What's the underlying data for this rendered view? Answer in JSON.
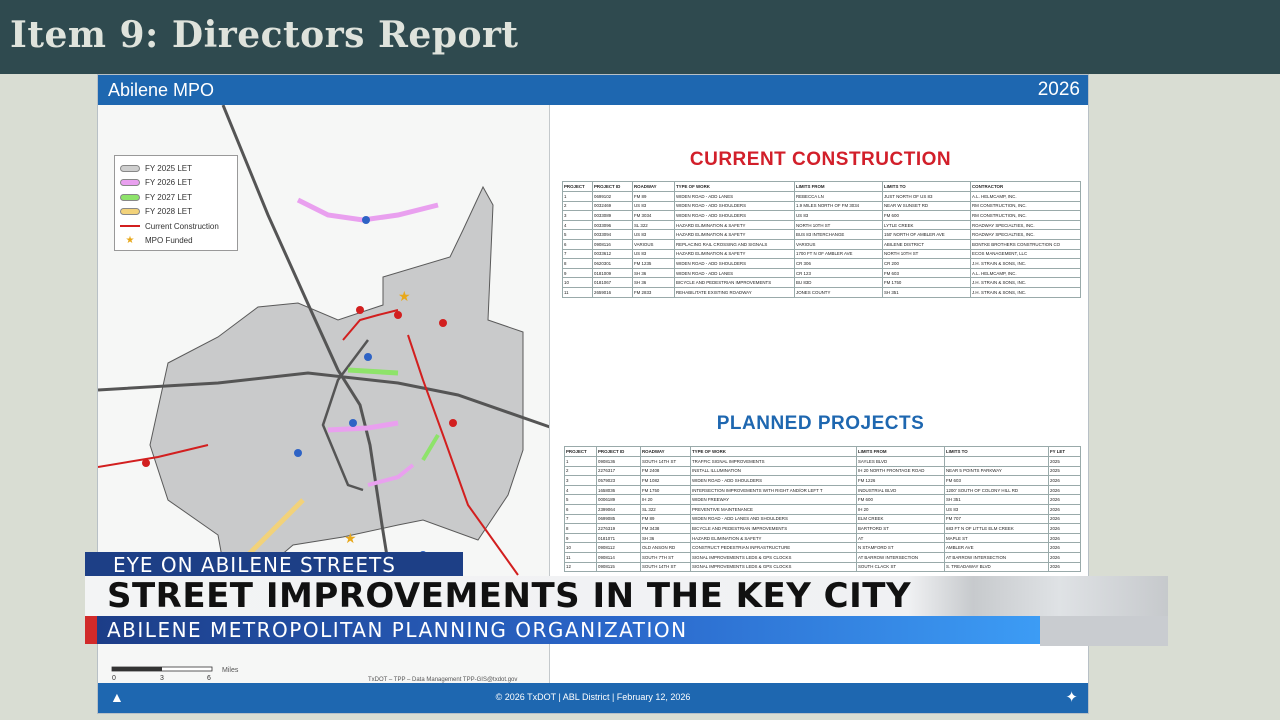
{
  "header": {
    "title": "Item 9: Directors Report"
  },
  "slide": {
    "org": "Abilene MPO",
    "year": "2026",
    "footer": "© 2026 TxDOT | ABL District | February 12, 2026",
    "north_arrow": "north-arrow-icon",
    "logo_icon": "txdot-logo-icon"
  },
  "map": {
    "legend": [
      {
        "label": "FY 2025 LET",
        "color": "#cfcfcf"
      },
      {
        "label": "FY 2026 LET",
        "color": "#e9a0ef"
      },
      {
        "label": "FY 2027 LET",
        "color": "#8ee36a"
      },
      {
        "label": "FY 2028 LET",
        "color": "#f2d27a"
      },
      {
        "label": "Current Construction",
        "color": "#d21f1f"
      },
      {
        "label": "MPO Funded",
        "color": "#e8a81a"
      }
    ],
    "reference": "TxDOT – TPP – Data Management TPP-GIS@txdot.gov",
    "scale_label": "Miles",
    "scale_ticks": [
      "0",
      "3",
      "6"
    ]
  },
  "current_construction": {
    "title": "CURRENT CONSTRUCTION",
    "columns": [
      "PROJECT",
      "PROJECT ID",
      "ROADWAY",
      "TYPE OF WORK",
      "LIMITS FROM",
      "LIMITS TO",
      "CONTRACTOR"
    ],
    "rows": [
      [
        "1",
        "0699102",
        "FM 89",
        "WIDEN ROAD - ADD LANES",
        "REBECCA LN",
        "JUST NORTH OF US 83",
        "A.L. HELMCAMP, INC."
      ],
      [
        "2",
        "0032469",
        "US 83",
        "WIDEN ROAD - ADD SHOULDERS",
        "1.9 MILES NORTH OF FM 3034",
        "NEAR W SUNSET RD",
        "RM CONSTRUCTION, INC."
      ],
      [
        "3",
        "0033089",
        "FM 3034",
        "WIDEN ROAD - ADD SHOULDERS",
        "US 83",
        "FM 600",
        "RM CONSTRUCTION, INC."
      ],
      [
        "4",
        "0033096",
        "SL 322",
        "HAZARD ELIMINATION & SAFETY",
        "NORTH 10TH ST",
        "LYTLE CREEK",
        "ROADWAY SPECIALTIES, INC."
      ],
      [
        "5",
        "0033094",
        "US 83",
        "HAZARD ELIMINATION & SAFETY",
        "BUS 83 INTERCHANGE",
        "150' NORTH OF AMBLER AVE",
        "ROADWAY SPECIALTIES, INC."
      ],
      [
        "6",
        "0908116",
        "VARIOUS",
        "REPLACING RAIL CROSSING AND SIGNALS",
        "VARIOUS",
        "ABILENE DISTRICT",
        "BONTKE BROTHERS CONSTRUCTION CO"
      ],
      [
        "7",
        "0033612",
        "US 83",
        "HAZARD ELIMINATION & SAFETY",
        "1700 FT N OF AMBLER AVE",
        "NORTH 10TH ST",
        "ECOS MANAGEMENT, LLC"
      ],
      [
        "8",
        "0620301",
        "FM 1235",
        "WIDEN ROAD - ADD SHOULDERS",
        "CR 306",
        "CR 200",
        "J.H. STRAIN & SONS, INC."
      ],
      [
        "9",
        "0181009",
        "SH 36",
        "WIDEN ROAD - ADD LANES",
        "CR 123",
        "FM 603",
        "A.L. HELMCAMP, INC."
      ],
      [
        "10",
        "0181067",
        "SH 36",
        "BICYCLE AND PEDESTRIAN IMPROVEMENTS",
        "BU 83D",
        "FM 1750",
        "J.H. STRAIN & SONS, INC."
      ],
      [
        "11",
        "2659016",
        "FM 2833",
        "REHABILITATE EXISTING ROADWAY",
        "JONES COUNTY",
        "SH 351",
        "J.H. STRAIN & SONS, INC."
      ]
    ]
  },
  "planned_projects": {
    "title": "PLANNED PROJECTS",
    "columns": [
      "PROJECT",
      "PROJECT ID",
      "ROADWAY",
      "TYPE OF WORK",
      "LIMITS FROM",
      "LIMITS TO",
      "FY LET"
    ],
    "rows": [
      [
        "1",
        "0908136",
        "SOUTH 14TH ST",
        "TRAFFIC SIGNAL IMPROVEMENTS",
        "SAYLES BLVD",
        "",
        "2025"
      ],
      [
        "2",
        "2276317",
        "FM 2408",
        "INSTALL ILLUMINATION",
        "IH 20 NORTH FRONTAGE ROAD",
        "NEAR 5 POINTS PARKWAY",
        "2025"
      ],
      [
        "3",
        "0579023",
        "FM 1082",
        "WIDEN ROAD - ADD SHOULDERS",
        "FM 1226",
        "FM 603",
        "2026"
      ],
      [
        "4",
        "1658036",
        "FM 1750",
        "INTERSECTION IMPROVEMENTS WITH RIGHT AND/OR LEFT T",
        "INDUSTRIAL BLVD",
        "1200' SOUTH OF COLONY HILL RD",
        "2026"
      ],
      [
        "5",
        "0006189",
        "IH 20",
        "WIDEN FREEWAY",
        "FM 600",
        "SH 351",
        "2026"
      ],
      [
        "6",
        "2399064",
        "SL 322",
        "PREVENTIVE MAINTENANCE",
        "IH 20",
        "US 83",
        "2026"
      ],
      [
        "7",
        "0699085",
        "FM 89",
        "WIDEN ROAD - ADD LANES AND SHOULDERS",
        "ELM CREEK",
        "FM 707",
        "2026"
      ],
      [
        "8",
        "2276319",
        "FM 3438",
        "BICYCLE AND PEDESTRIAN IMPROVEMENTS",
        "BARTFORD ST",
        "683 FT N OF LITTLE ELM CREEK",
        "2026"
      ],
      [
        "9",
        "0181071",
        "SH 36",
        "HAZARD ELIMINATION & SAFETY",
        "AT",
        "MAPLE ST",
        "2026"
      ],
      [
        "10",
        "0908112",
        "OLD ANSON RD",
        "CONSTRUCT PEDESTRIAN INFRASTRUCTURE",
        "N STAMFORD ST",
        "AMBLER AVE",
        "2026"
      ],
      [
        "11",
        "0908114",
        "SOUTH 7TH ST",
        "SIGNAL IMPROVEMENTS LEDS & GPS CLOCKS",
        "AT BARROW INTERSECTION",
        "AT BARROW INTERSECTION",
        "2026"
      ],
      [
        "12",
        "0908115",
        "SOUTH 14TH ST",
        "SIGNAL IMPROVEMENTS LEDS & GPS CLOCKS",
        "SOUTH CLACK ST",
        "S. TREADAWAY BLVD",
        "2026"
      ]
    ]
  },
  "lower_third": {
    "kicker": "EYE ON ABILENE STREETS",
    "headline": "STREET IMPROVEMENTS IN THE KEY CITY",
    "subline": "ABILENE METROPOLITAN PLANNING ORGANIZATION"
  }
}
